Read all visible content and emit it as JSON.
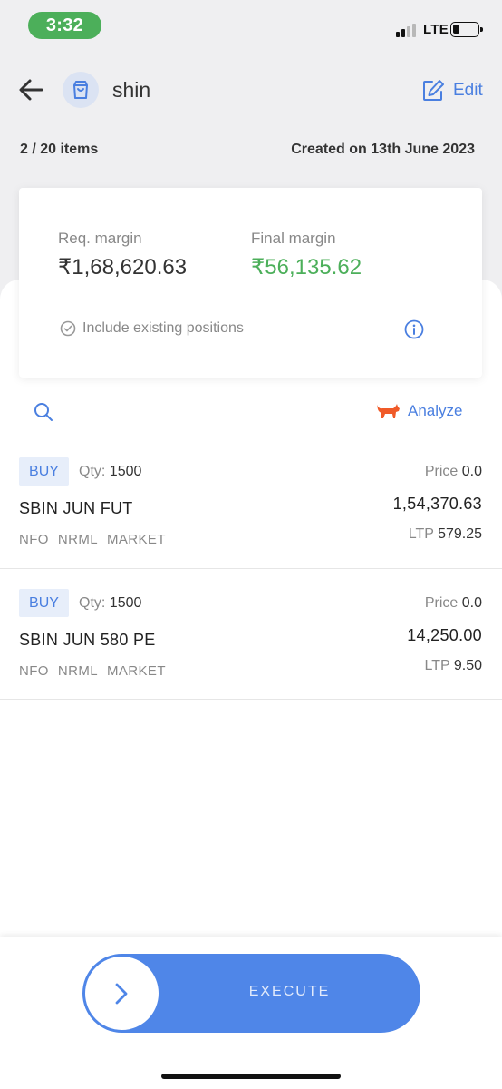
{
  "status_bar": {
    "time": "3:32",
    "network": "LTE"
  },
  "header": {
    "basket_name": "shin",
    "edit_label": "Edit"
  },
  "summary": {
    "items_count": "2 / 20 items",
    "created": "Created on 13th June 2023"
  },
  "margin": {
    "req_label": "Req. margin",
    "req_value": "₹1,68,620.63",
    "final_label": "Final margin",
    "final_value": "₹56,135.62",
    "include_label": "Include existing positions"
  },
  "toolbar": {
    "analyze_label": "Analyze"
  },
  "orders": [
    {
      "side": "BUY",
      "qty_label": "Qty:",
      "qty": "1500",
      "symbol": "SBIN JUN FUT",
      "exchange": "NFO",
      "product": "NRML",
      "order_type": "MARKET",
      "price_label": "Price",
      "price": "0.0",
      "amount": "1,54,370.63",
      "ltp_label": "LTP",
      "ltp": "579.25"
    },
    {
      "side": "BUY",
      "qty_label": "Qty:",
      "qty": "1500",
      "symbol": "SBIN JUN 580 PE",
      "exchange": "NFO",
      "product": "NRML",
      "order_type": "MARKET",
      "price_label": "Price",
      "price": "0.0",
      "amount": "14,250.00",
      "ltp_label": "LTP",
      "ltp": "9.50"
    }
  ],
  "execute": {
    "label": "EXECUTE"
  },
  "colors": {
    "accent": "#4a7fe0",
    "positive": "#4caf5a",
    "status_pill": "#4caf5a",
    "execute_bg": "#4f86e8",
    "analyze_icon": "#f05a28"
  },
  "icons": {
    "back": "arrow-left-icon",
    "basket": "shopping-bag-icon",
    "edit": "edit-icon",
    "include": "check-circle-icon",
    "info": "info-icon",
    "search": "search-icon",
    "analyze": "bull-icon",
    "execute": "chevron-right-icon"
  }
}
